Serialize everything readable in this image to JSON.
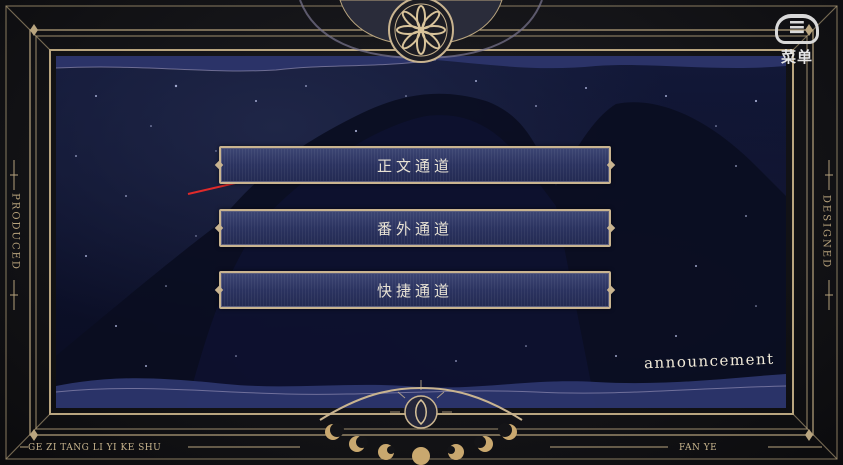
{
  "menu": {
    "buttons": [
      {
        "label": "正文通道"
      },
      {
        "label": "番外通道"
      },
      {
        "label": "快捷通道"
      }
    ]
  },
  "announcement": {
    "label": "announcement"
  },
  "frame": {
    "left_side_text": "PRODUCED",
    "right_side_text": "DESIGNED",
    "bottom_left_text": "GE ZI TANG LI YI KE SHU",
    "bottom_right_text": "FAN YE"
  },
  "watermark": {
    "label": "菜单",
    "icon": "cloud-icon"
  },
  "colors": {
    "gold": "#c9b490",
    "panel": "#2b3360",
    "sky": "#0c1029",
    "arrow": "#e02a2a"
  }
}
